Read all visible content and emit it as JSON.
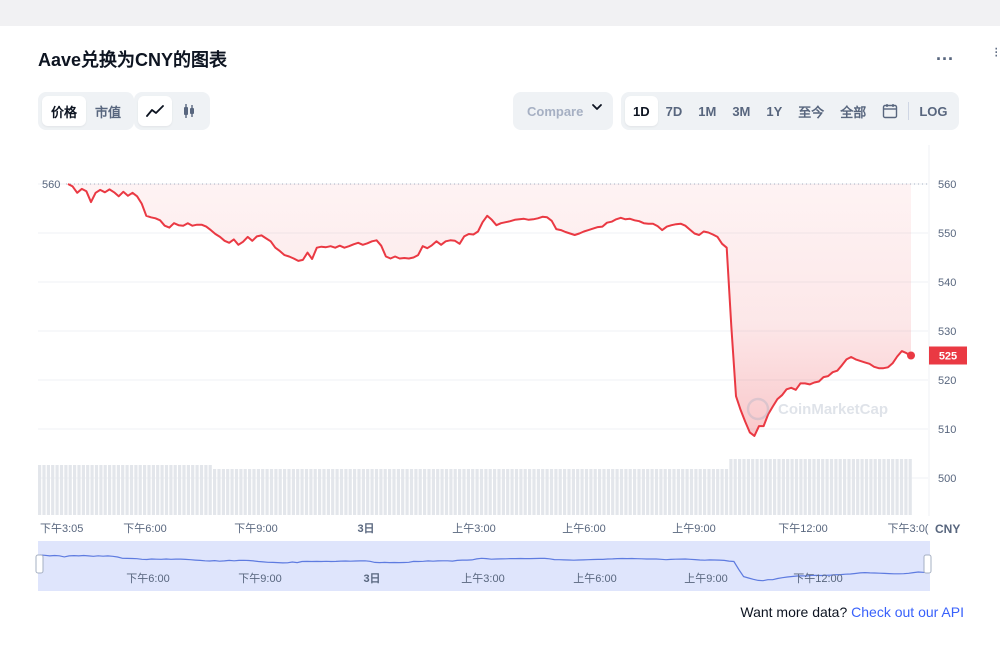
{
  "page": {
    "title": "Aave兑换为CNY的图表",
    "more_label": "...",
    "edge_mark": "⁝"
  },
  "toolbar": {
    "mode_tabs": [
      {
        "label": "价格",
        "active": true
      },
      {
        "label": "市值",
        "active": false
      }
    ],
    "chart_type_icons": [
      {
        "name": "line-chart-icon",
        "active": true
      },
      {
        "name": "candlestick-icon",
        "active": false
      }
    ],
    "compare_label": "Compare  ",
    "range_tabs": [
      {
        "label": "1D",
        "active": true
      },
      {
        "label": "7D",
        "active": false
      },
      {
        "label": "1M",
        "active": false
      },
      {
        "label": "3M",
        "active": false
      },
      {
        "label": "1Y",
        "active": false
      },
      {
        "label": "至今",
        "active": false
      },
      {
        "label": "全部",
        "active": false
      }
    ],
    "calendar_icon": "calendar-icon",
    "log_label": "LOG"
  },
  "chart_data": {
    "type": "line",
    "ylim": [
      495,
      568
    ],
    "yticks": [
      500,
      510,
      520,
      530,
      540,
      550,
      560
    ],
    "open_marker": 560,
    "currency_label": "CNY",
    "current_price": 525,
    "watermark": "CoinMarketCap",
    "x_labels": [
      "下午3:05",
      "下午6:00",
      "下午9:00",
      "3日",
      "上午3:00",
      "上午6:00",
      "上午9:00",
      "下午12:00",
      "下午3:0("
    ],
    "navigator_labels": [
      "下午6:00",
      "下午9:00",
      "3日",
      "上午3:00",
      "上午6:00",
      "上午9:00",
      "下午12:00"
    ],
    "series": [
      {
        "values": [
          560,
          559.5,
          558.2,
          559,
          558.5,
          556.3,
          558.2,
          558.8,
          558.3,
          558.9,
          558.3,
          557.5,
          558.4,
          557.6,
          558.2,
          557.5,
          556,
          553.5,
          553.2,
          553,
          552.6,
          551.5,
          551.1,
          552,
          551.6,
          551.5,
          552,
          551.5,
          551.7,
          551.7,
          551.3,
          550.6,
          549.8,
          549.2,
          548.4,
          548,
          548.7,
          547.6,
          548.2,
          549.2,
          548.4,
          549.3,
          549.5,
          548.9,
          548.3,
          547,
          546.3,
          545.5,
          545.2,
          544.8,
          544.3,
          544.5,
          546,
          544.7,
          547,
          547.2,
          547.1,
          547.3,
          547,
          547.4,
          547,
          547.3,
          547.7,
          548,
          547.6,
          547.9,
          548.3,
          548.5,
          547.4,
          545.2,
          544.8,
          545.2,
          544.8,
          544.9,
          544.8,
          545,
          545.5,
          547.3,
          546.9,
          547.5,
          548.3,
          547.6,
          548.3,
          548.5,
          548.4,
          547.8,
          549.3,
          549.8,
          549.7,
          550.3,
          552.2,
          553.5,
          552.7,
          551.6,
          552,
          552.2,
          552.4,
          552.7,
          552.8,
          552.9,
          552.7,
          552.8,
          553,
          553.3,
          553.2,
          552.5,
          550.8,
          550.6,
          550.2,
          549.9,
          549.6,
          549.9,
          550.3,
          550.6,
          550.9,
          551.2,
          551.3,
          552.1,
          552.3,
          552.8,
          553.1,
          552.8,
          552.9,
          552.6,
          552.4,
          552,
          551.9,
          551.9,
          551.4,
          550.6,
          551.3,
          551.6,
          551.8,
          551.9,
          551.5,
          550.7,
          549.9,
          549.6,
          550.3,
          550.1,
          549.7,
          549.2,
          547.8,
          547,
          531,
          516.7,
          513.9,
          511.5,
          509.3,
          508.6,
          510.6,
          510.6,
          513,
          514.6,
          516.1,
          516.9,
          518.1,
          518.4,
          518,
          519.3,
          519.3,
          519.1,
          519.5,
          519.7,
          520.6,
          520.8,
          521.6,
          521.9,
          523,
          524.2,
          524.7,
          524.2,
          523.9,
          523.6,
          523.3,
          522.7,
          522.4,
          522.4,
          522.6,
          523.4,
          524.8,
          525.9,
          525.5,
          524.8
        ]
      }
    ]
  },
  "footer": {
    "api_prompt": "Want more data?",
    "api_link": "Check out our API"
  }
}
